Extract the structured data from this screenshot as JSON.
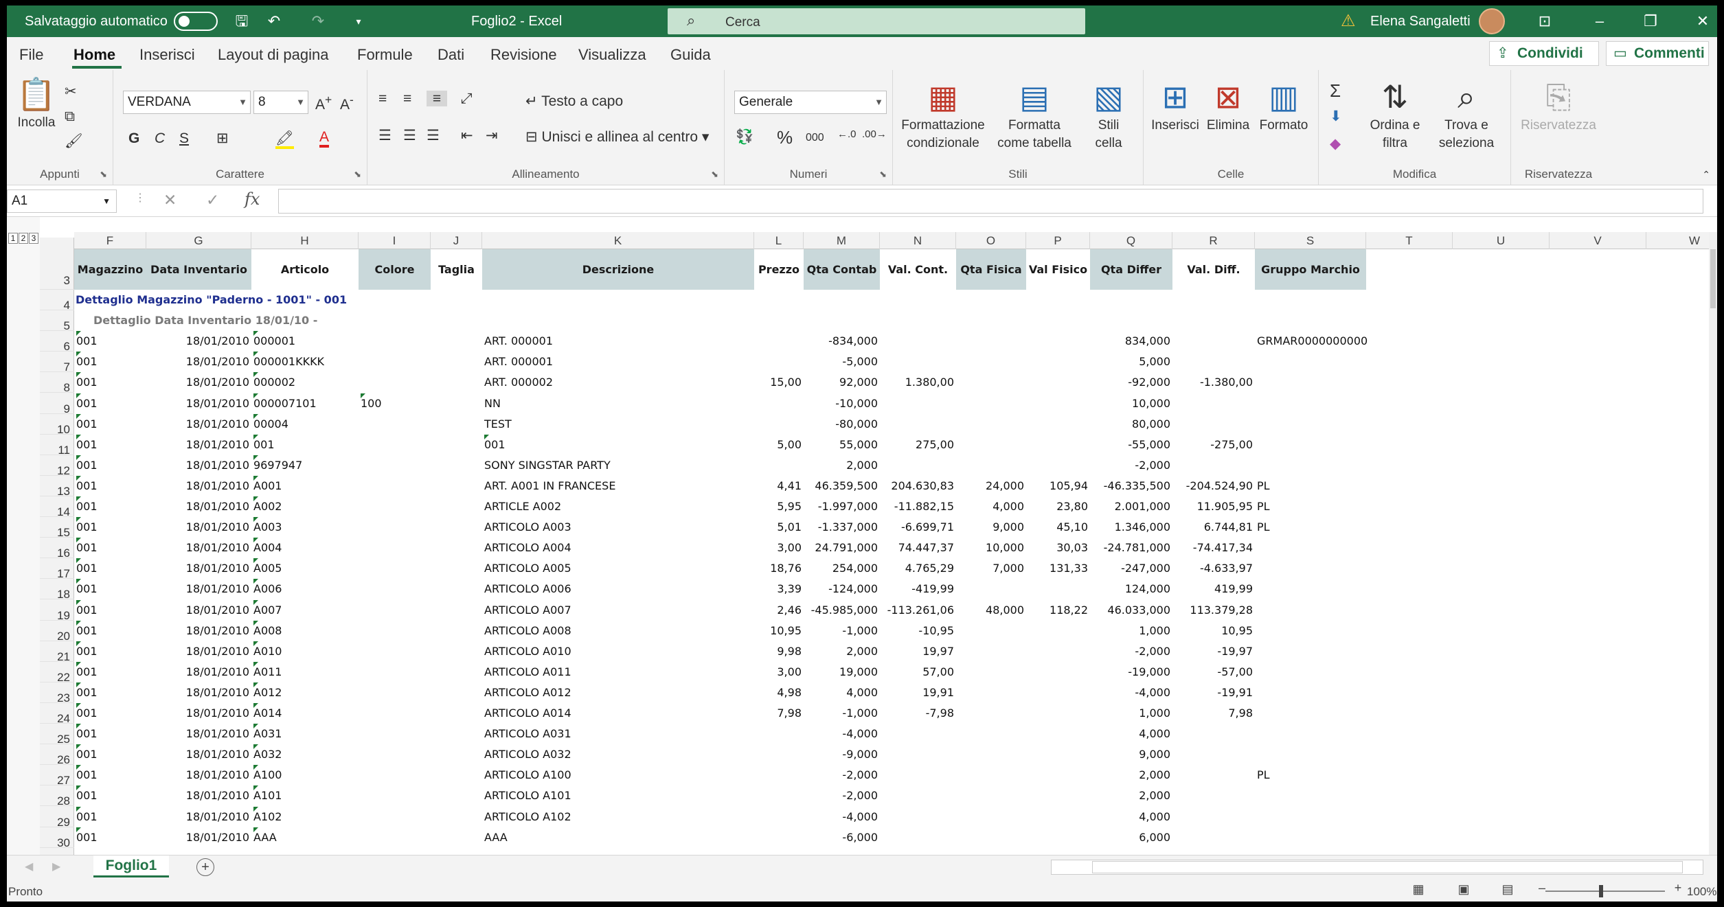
{
  "titlebar": {
    "autosave": "Salvataggio automatico",
    "doc_title": "Foglio2 - Excel",
    "search_placeholder": "Cerca",
    "user": "Elena Sangaletti"
  },
  "menu": {
    "items": [
      "File",
      "Home",
      "Inserisci",
      "Layout di pagina",
      "Formule",
      "Dati",
      "Revisione",
      "Visualizza",
      "Guida"
    ],
    "share": "Condividi",
    "comments": "Commenti"
  },
  "ribbon": {
    "paste": "Incolla",
    "clipboard_label": "Appunti",
    "font_name": "VERDANA",
    "font_size": "8",
    "bold": "G",
    "italic": "C",
    "underline": "S",
    "font_label": "Carattere",
    "wrap_text": "Testo a capo",
    "merge_center": "Unisci e allinea al centro",
    "alignment_label": "Allineamento",
    "number_format": "Generale",
    "percent": "%",
    "thousands": "000",
    "number_label": "Numeri",
    "cond_format": "Formattazione condizionale",
    "format_table": "Formatta come tabella",
    "cell_styles": "Stili cella",
    "styles_label": "Stili",
    "insert": "Inserisci",
    "delete": "Elimina",
    "format": "Formato",
    "cells_label": "Celle",
    "sort_filter": "Ordina e filtra",
    "find_select": "Trova e seleziona",
    "editing_label": "Modifica",
    "privacy": "Riservatezza",
    "privacy_label": "Riservatezza"
  },
  "formula_bar": {
    "name_box": "A1",
    "fx": "fx",
    "formula": ""
  },
  "outline_levels": [
    "1",
    "2",
    "3"
  ],
  "columns": [
    "F",
    "G",
    "H",
    "I",
    "J",
    "K",
    "L",
    "M",
    "N",
    "O",
    "P",
    "Q",
    "R",
    "S",
    "T",
    "U",
    "V",
    "W"
  ],
  "headers": {
    "F": "Magazzino",
    "G": "Data Inventario",
    "H": "Articolo",
    "I": "Colore",
    "J": "Taglia",
    "K": "Descrizione",
    "L": "Prezzo",
    "M": "Qta Contab",
    "N": "Val. Cont.",
    "O": "Qta Fisica",
    "P": "Val Fisico",
    "Q": "Qta Differ",
    "R": "Val. Diff.",
    "S": "Gruppo Marchio"
  },
  "group_row": {
    "row": "4",
    "text": "Dettaglio Magazzino \"Paderno - 1001\" - 001"
  },
  "subgroup_row": {
    "row": "5",
    "text": "Dettaglio Data Inventario 18/01/10  -"
  },
  "rows": [
    {
      "row": "6",
      "F": "001",
      "G": "18/01/2010",
      "H": "000001",
      "I": "",
      "K": "ART. 000001",
      "L": "",
      "M": "-834,000",
      "N": "",
      "O": "",
      "P": "",
      "Q": "834,000",
      "R": "",
      "S": "GRMAR0000000000"
    },
    {
      "row": "7",
      "F": "001",
      "G": "18/01/2010",
      "H": "000001KKKK",
      "I": "",
      "K": "ART. 000001",
      "L": "",
      "M": "-5,000",
      "N": "",
      "O": "",
      "P": "",
      "Q": "5,000",
      "R": "",
      "S": ""
    },
    {
      "row": "8",
      "F": "001",
      "G": "18/01/2010",
      "H": "000002",
      "I": "",
      "K": "ART. 000002",
      "L": "15,00",
      "M": "92,000",
      "N": "1.380,00",
      "O": "",
      "P": "",
      "Q": "-92,000",
      "R": "-1.380,00",
      "S": ""
    },
    {
      "row": "9",
      "F": "001",
      "G": "18/01/2010",
      "H": "000007101",
      "I": "100",
      "K": "NN",
      "L": "",
      "M": "-10,000",
      "N": "",
      "O": "",
      "P": "",
      "Q": "10,000",
      "R": "",
      "S": ""
    },
    {
      "row": "10",
      "F": "001",
      "G": "18/01/2010",
      "H": "00004",
      "I": "",
      "K": "TEST",
      "L": "",
      "M": "-80,000",
      "N": "",
      "O": "",
      "P": "",
      "Q": "80,000",
      "R": "",
      "S": ""
    },
    {
      "row": "11",
      "F": "001",
      "G": "18/01/2010",
      "H": "001",
      "I": "",
      "K": "001",
      "L": "5,00",
      "M": "55,000",
      "N": "275,00",
      "O": "",
      "P": "",
      "Q": "-55,000",
      "R": "-275,00",
      "S": ""
    },
    {
      "row": "12",
      "F": "001",
      "G": "18/01/2010",
      "H": "9697947",
      "I": "",
      "K": "SONY SINGSTAR PARTY",
      "L": "",
      "M": "2,000",
      "N": "",
      "O": "",
      "P": "",
      "Q": "-2,000",
      "R": "",
      "S": ""
    },
    {
      "row": "13",
      "F": "001",
      "G": "18/01/2010",
      "H": "A001",
      "I": "",
      "K": "ART. A001 IN FRANCESE",
      "L": "4,41",
      "M": "46.359,500",
      "N": "204.630,83",
      "O": "24,000",
      "P": "105,94",
      "Q": "-46.335,500",
      "R": "-204.524,90",
      "S": "PL"
    },
    {
      "row": "14",
      "F": "001",
      "G": "18/01/2010",
      "H": "A002",
      "I": "",
      "K": "ARTICLE A002",
      "L": "5,95",
      "M": "-1.997,000",
      "N": "-11.882,15",
      "O": "4,000",
      "P": "23,80",
      "Q": "2.001,000",
      "R": "11.905,95",
      "S": "PL"
    },
    {
      "row": "15",
      "F": "001",
      "G": "18/01/2010",
      "H": "A003",
      "I": "",
      "K": "ARTICOLO A003",
      "L": "5,01",
      "M": "-1.337,000",
      "N": "-6.699,71",
      "O": "9,000",
      "P": "45,10",
      "Q": "1.346,000",
      "R": "6.744,81",
      "S": "PL"
    },
    {
      "row": "16",
      "F": "001",
      "G": "18/01/2010",
      "H": "A004",
      "I": "",
      "K": "ARTICOLO A004",
      "L": "3,00",
      "M": "24.791,000",
      "N": "74.447,37",
      "O": "10,000",
      "P": "30,03",
      "Q": "-24.781,000",
      "R": "-74.417,34",
      "S": ""
    },
    {
      "row": "17",
      "F": "001",
      "G": "18/01/2010",
      "H": "A005",
      "I": "",
      "K": "ARTICOLO A005",
      "L": "18,76",
      "M": "254,000",
      "N": "4.765,29",
      "O": "7,000",
      "P": "131,33",
      "Q": "-247,000",
      "R": "-4.633,97",
      "S": ""
    },
    {
      "row": "18",
      "F": "001",
      "G": "18/01/2010",
      "H": "A006",
      "I": "",
      "K": "ARTICOLO A006",
      "L": "3,39",
      "M": "-124,000",
      "N": "-419,99",
      "O": "",
      "P": "",
      "Q": "124,000",
      "R": "419,99",
      "S": ""
    },
    {
      "row": "19",
      "F": "001",
      "G": "18/01/2010",
      "H": "A007",
      "I": "",
      "K": "ARTICOLO A007",
      "L": "2,46",
      "M": "-45.985,000",
      "N": "-113.261,06",
      "O": "48,000",
      "P": "118,22",
      "Q": "46.033,000",
      "R": "113.379,28",
      "S": ""
    },
    {
      "row": "20",
      "F": "001",
      "G": "18/01/2010",
      "H": "A008",
      "I": "",
      "K": "ARTICOLO A008",
      "L": "10,95",
      "M": "-1,000",
      "N": "-10,95",
      "O": "",
      "P": "",
      "Q": "1,000",
      "R": "10,95",
      "S": ""
    },
    {
      "row": "21",
      "F": "001",
      "G": "18/01/2010",
      "H": "A010",
      "I": "",
      "K": "ARTICOLO A010",
      "L": "9,98",
      "M": "2,000",
      "N": "19,97",
      "O": "",
      "P": "",
      "Q": "-2,000",
      "R": "-19,97",
      "S": ""
    },
    {
      "row": "22",
      "F": "001",
      "G": "18/01/2010",
      "H": "A011",
      "I": "",
      "K": "ARTICOLO A011",
      "L": "3,00",
      "M": "19,000",
      "N": "57,00",
      "O": "",
      "P": "",
      "Q": "-19,000",
      "R": "-57,00",
      "S": ""
    },
    {
      "row": "23",
      "F": "001",
      "G": "18/01/2010",
      "H": "A012",
      "I": "",
      "K": "ARTICOLO A012",
      "L": "4,98",
      "M": "4,000",
      "N": "19,91",
      "O": "",
      "P": "",
      "Q": "-4,000",
      "R": "-19,91",
      "S": ""
    },
    {
      "row": "24",
      "F": "001",
      "G": "18/01/2010",
      "H": "A014",
      "I": "",
      "K": "ARTICOLO A014",
      "L": "7,98",
      "M": "-1,000",
      "N": "-7,98",
      "O": "",
      "P": "",
      "Q": "1,000",
      "R": "7,98",
      "S": ""
    },
    {
      "row": "25",
      "F": "001",
      "G": "18/01/2010",
      "H": "A031",
      "I": "",
      "K": "ARTICOLO A031",
      "L": "",
      "M": "-4,000",
      "N": "",
      "O": "",
      "P": "",
      "Q": "4,000",
      "R": "",
      "S": ""
    },
    {
      "row": "26",
      "F": "001",
      "G": "18/01/2010",
      "H": "A032",
      "I": "",
      "K": "ARTICOLO A032",
      "L": "",
      "M": "-9,000",
      "N": "",
      "O": "",
      "P": "",
      "Q": "9,000",
      "R": "",
      "S": ""
    },
    {
      "row": "27",
      "F": "001",
      "G": "18/01/2010",
      "H": "A100",
      "I": "",
      "K": "ARTICOLO A100",
      "L": "",
      "M": "-2,000",
      "N": "",
      "O": "",
      "P": "",
      "Q": "2,000",
      "R": "",
      "S": "PL"
    },
    {
      "row": "28",
      "F": "001",
      "G": "18/01/2010",
      "H": "A101",
      "I": "",
      "K": "ARTICOLO A101",
      "L": "",
      "M": "-2,000",
      "N": "",
      "O": "",
      "P": "",
      "Q": "2,000",
      "R": "",
      "S": ""
    },
    {
      "row": "29",
      "F": "001",
      "G": "18/01/2010",
      "H": "A102",
      "I": "",
      "K": "ARTICOLO A102",
      "L": "",
      "M": "-4,000",
      "N": "",
      "O": "",
      "P": "",
      "Q": "4,000",
      "R": "",
      "S": ""
    },
    {
      "row": "30",
      "F": "001",
      "G": "18/01/2010",
      "H": "AAA",
      "I": "",
      "K": "AAA",
      "L": "",
      "M": "-6,000",
      "N": "",
      "O": "",
      "P": "",
      "Q": "6,000",
      "R": "",
      "S": ""
    }
  ],
  "sheet_tab": "Foglio1",
  "status": {
    "text": "Pronto",
    "zoom": "100%"
  },
  "colors": {
    "accent": "#217346",
    "header_fill": "#c9d8da",
    "header_fill_alt": "#dbe7e8",
    "group_text": "#1f2f8f",
    "subgroup_text": "#7a7a7a"
  }
}
